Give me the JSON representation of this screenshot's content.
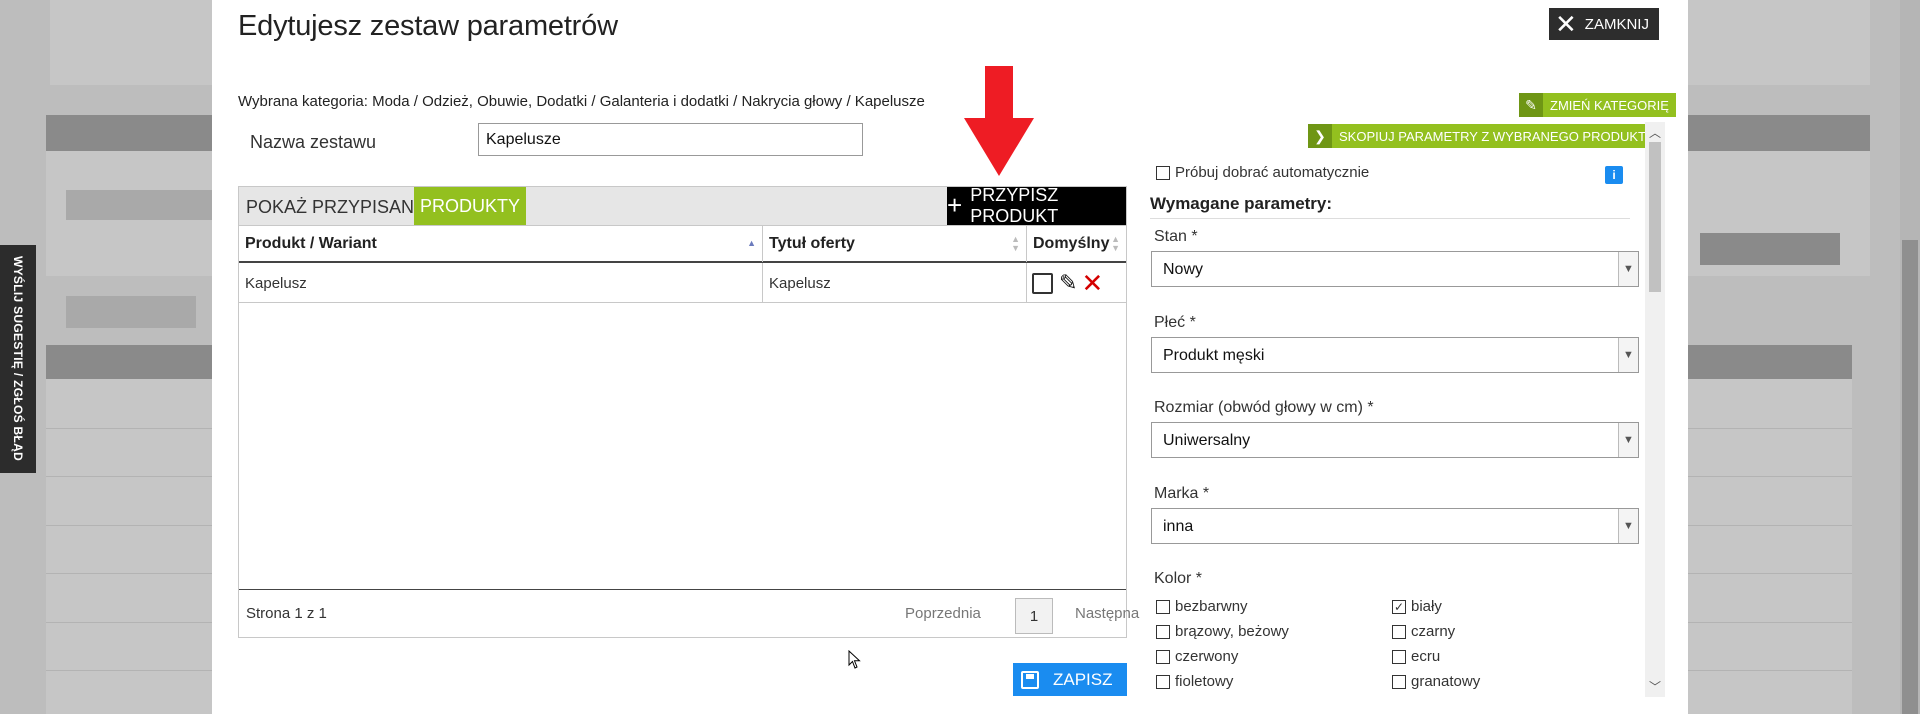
{
  "side_tab": {
    "label": "WYŚLIJ SUGESTIĘ / ZGŁOŚ BŁĄD"
  },
  "modal": {
    "title": "Edytujesz zestaw parametrów",
    "close_label": "ZAMKNIJ",
    "breadcrumb": "Wybrana kategoria: Moda / Odzież, Obuwie, Dodatki / Galanteria i dodatki / Nakrycia głowy / Kapelusze",
    "change_category_label": "ZMIEŃ KATEGORIĘ",
    "copy_params_label": "SKOPIUJ PARAMETRY Z WYBRANEGO PRODUKTU",
    "set_name_label": "Nazwa zestawu",
    "set_name_value": "Kapelusze",
    "show_assigned_label": "POKAŻ PRZYPISANE:",
    "tab_products_label": "PRODUKTY",
    "assign_product_label": "PRZYPISZ PRODUKT",
    "table": {
      "columns": [
        "Produkt / Wariant",
        "Tytuł oferty",
        "Domyślny"
      ],
      "rows": [
        {
          "product": "Kapelusz",
          "title": "Kapelusz"
        }
      ]
    },
    "pager": {
      "info": "Strona 1 z 1",
      "prev": "Poprzednia",
      "page": "1",
      "next": "Następna"
    },
    "save_label": "ZAPISZ"
  },
  "params": {
    "auto_label": "Próbuj dobrać automatycznie",
    "info_icon": "i",
    "required_title": "Wymagane parametry:",
    "fields": [
      {
        "label": "Stan *",
        "value": "Nowy"
      },
      {
        "label": "Płeć *",
        "value": "Produkt męski"
      },
      {
        "label": "Rozmiar (obwód głowy w cm) *",
        "value": "Uniwersalny"
      },
      {
        "label": "Marka *",
        "value": "inna"
      }
    ],
    "color_label": "Kolor *",
    "colors": [
      {
        "name": "bezbarwny",
        "checked": false
      },
      {
        "name": "biały",
        "checked": true
      },
      {
        "name": "brązowy, beżowy",
        "checked": false
      },
      {
        "name": "czarny",
        "checked": false
      },
      {
        "name": "czerwony",
        "checked": false
      },
      {
        "name": "ecru",
        "checked": false
      },
      {
        "name": "fioletowy",
        "checked": false
      },
      {
        "name": "granatowy",
        "checked": false
      }
    ]
  },
  "colors": {
    "green": "#93c01f",
    "blue": "#1a8cf0",
    "red_arrow": "#ee1c24",
    "dark": "#2d2d2d"
  }
}
